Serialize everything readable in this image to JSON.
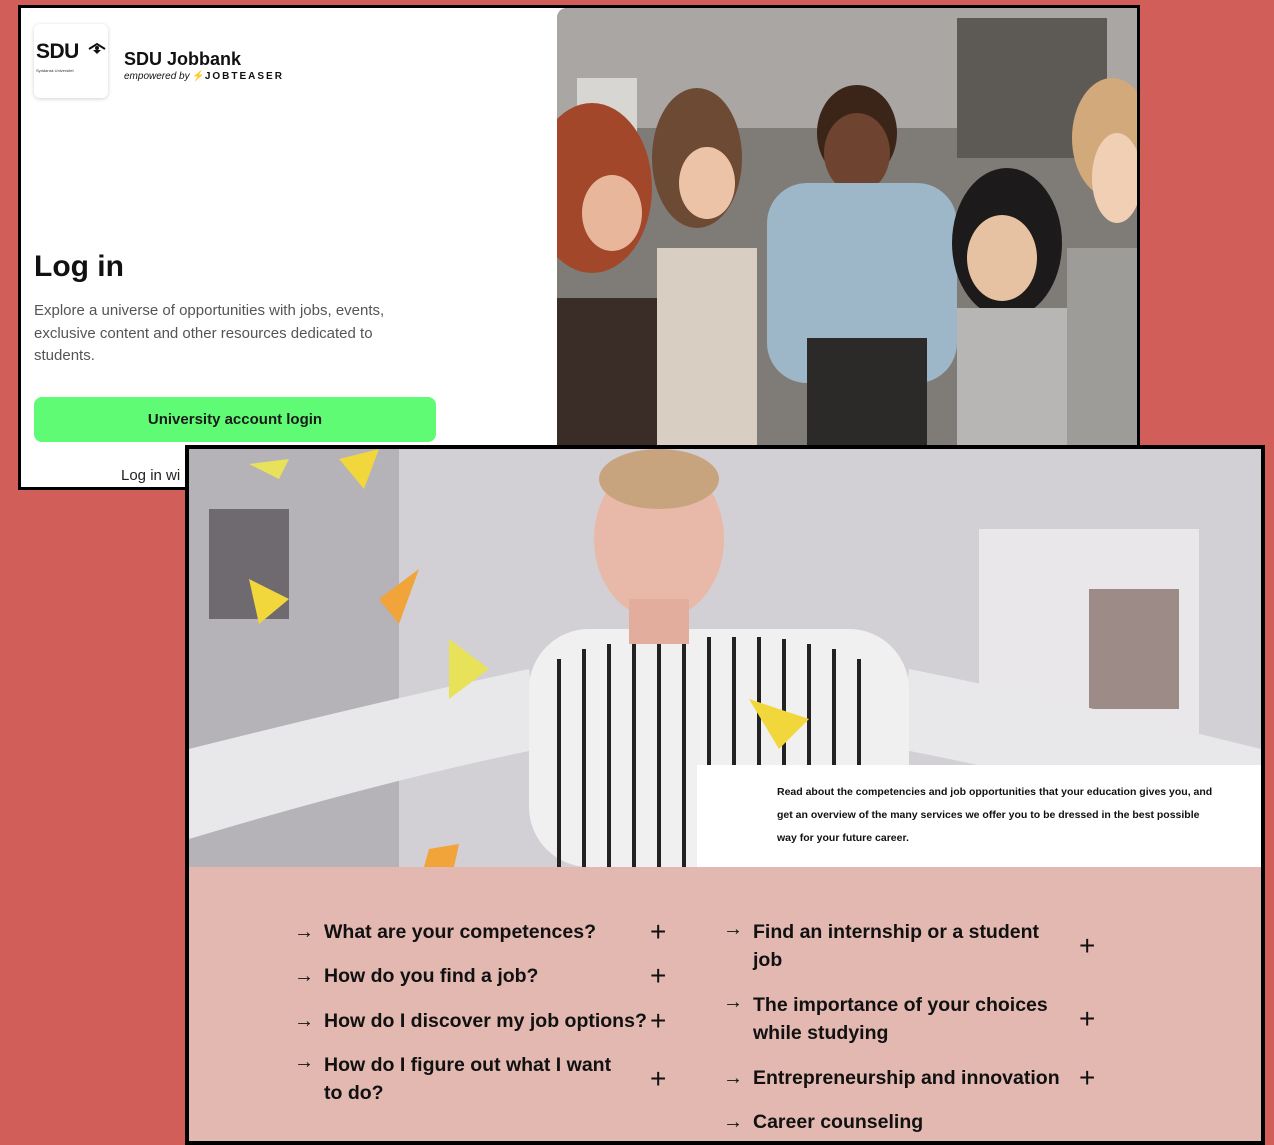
{
  "login": {
    "logo_text": "SDU",
    "logo_subtext": "Syddansk Universitet",
    "app_title": "SDU Jobbank",
    "app_sub_prefix": "empowered by",
    "app_sub_brand": "JOBTEASER",
    "title": "Log in",
    "description": "Explore a universe of opportunities with jobs, events, exclusive content and other resources dedicated to students.",
    "university_button": "University account login",
    "alt_login_partial": "Log in wi"
  },
  "career": {
    "intro": "Read about the competencies and job opportunities that your education gives you, and get an overview of the many services we offer you to be dressed in the best possible way for your future career.",
    "left_items": [
      {
        "label": "What are your competences?"
      },
      {
        "label": "How do you find a job?"
      },
      {
        "label": "How do I discover my job options?"
      },
      {
        "label": "How do I figure out what I want to do?"
      }
    ],
    "right_items": [
      {
        "label": "Find an internship or a student job"
      },
      {
        "label": "The importance of your choices while studying"
      },
      {
        "label": "Entrepreneurship and innovation"
      },
      {
        "label": "Career counseling"
      }
    ]
  },
  "icons": {
    "arrow": "→",
    "plus": "+"
  },
  "colors": {
    "background": "#d15e59",
    "login_button": "#5ffb74",
    "career_panel": "#e2b8b1"
  }
}
